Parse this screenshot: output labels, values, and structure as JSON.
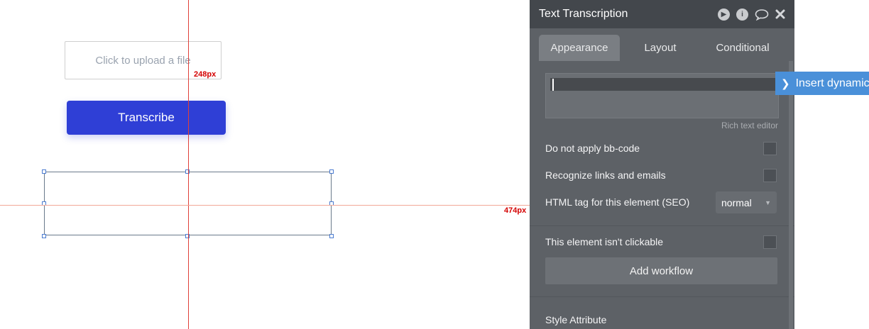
{
  "canvas": {
    "upload_placeholder": "Click to upload a file",
    "transcribe_label": "Transcribe",
    "guide_label_vertical": "248px",
    "guide_label_horizontal": "474px"
  },
  "panel": {
    "title": "Text Transcription",
    "header_icons": [
      "play-icon",
      "info-icon",
      "comment-icon",
      "close-icon"
    ],
    "tabs": [
      {
        "label": "Appearance",
        "active": true
      },
      {
        "label": "Layout",
        "active": false
      },
      {
        "label": "Conditional",
        "active": false
      }
    ],
    "rich_text_caption": "Rich text editor",
    "insert_dynamic_label": "Insert dynamic data",
    "options": {
      "no_bbcode_label": "Do not apply bb-code",
      "recognize_links_label": "Recognize links and emails",
      "html_tag_label": "HTML tag for this element (SEO)",
      "html_tag_value": "normal",
      "not_clickable_label": "This element isn't clickable"
    },
    "add_workflow_label": "Add workflow",
    "style_attribute_label": "Style Attribute"
  },
  "colors": {
    "primary_button": "#2f3fd6",
    "guide_line": "#e0403a",
    "panel_bg": "#5d6166",
    "dynamic_button": "#4a90d9"
  }
}
